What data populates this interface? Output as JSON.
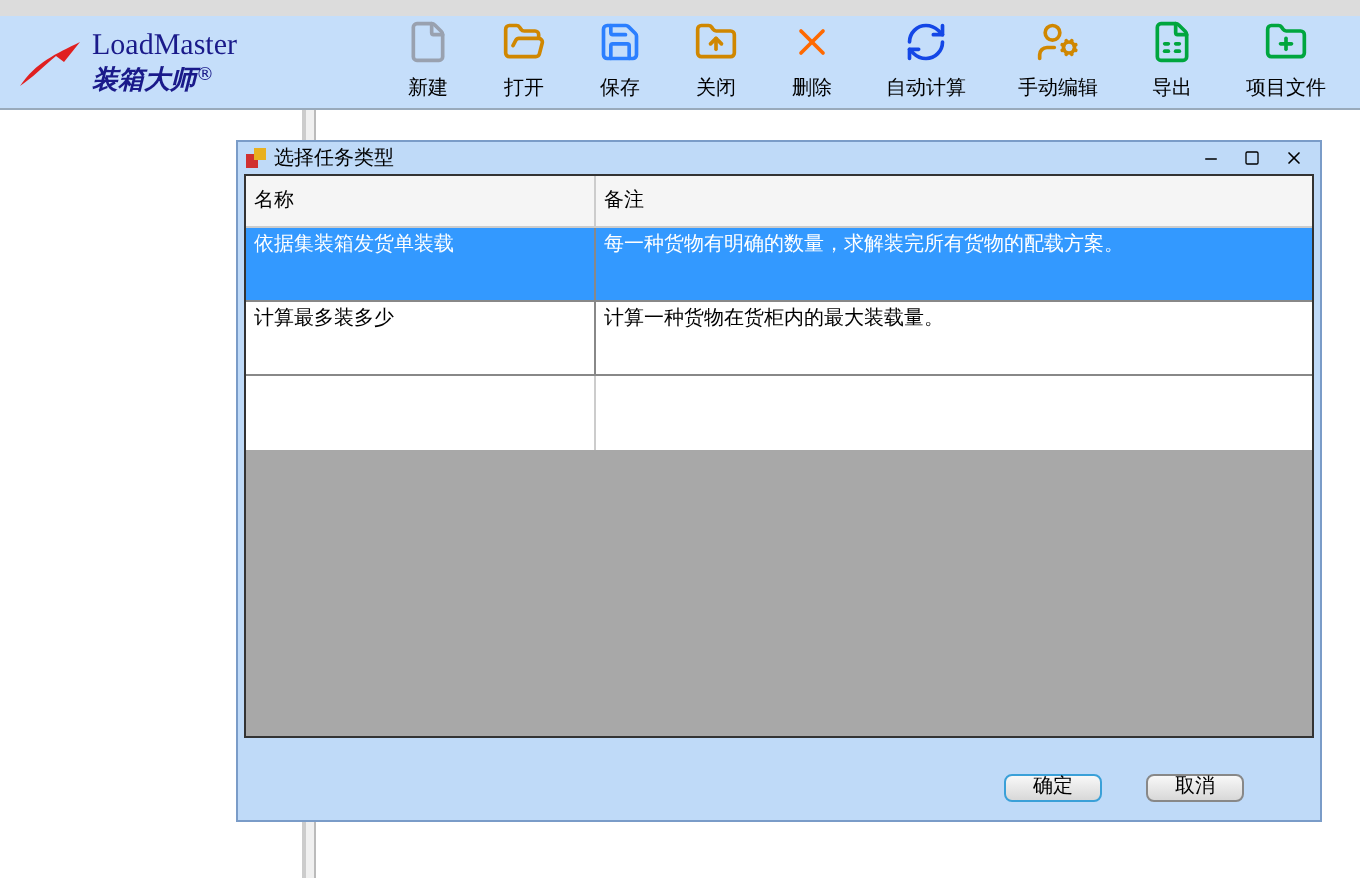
{
  "logo": {
    "name": "LoadMaster",
    "subtitle": "装箱大师",
    "mark": "®"
  },
  "toolbar": [
    {
      "label": "新建",
      "kind": "new"
    },
    {
      "label": "打开",
      "kind": "open"
    },
    {
      "label": "保存",
      "kind": "save"
    },
    {
      "label": "关闭",
      "kind": "close"
    },
    {
      "label": "删除",
      "kind": "delete"
    },
    {
      "label": "自动计算",
      "kind": "auto"
    },
    {
      "label": "手动编辑",
      "kind": "manual"
    },
    {
      "label": "导出",
      "kind": "export"
    },
    {
      "label": "项目文件",
      "kind": "project"
    }
  ],
  "dialog": {
    "title": "选择任务类型",
    "table": {
      "columns": [
        "名称",
        "备注"
      ],
      "rows": [
        {
          "cells": [
            "依据集装箱发货单装载",
            "每一种货物有明确的数量，求解装完所有货物的配载方案。"
          ],
          "selected": true
        },
        {
          "cells": [
            "计算最多装多少",
            "计算一种货物在货柜内的最大装载量。"
          ],
          "selected": false
        }
      ]
    },
    "buttons": [
      {
        "label": "确定",
        "default": true
      },
      {
        "label": "取消",
        "default": false
      }
    ]
  }
}
